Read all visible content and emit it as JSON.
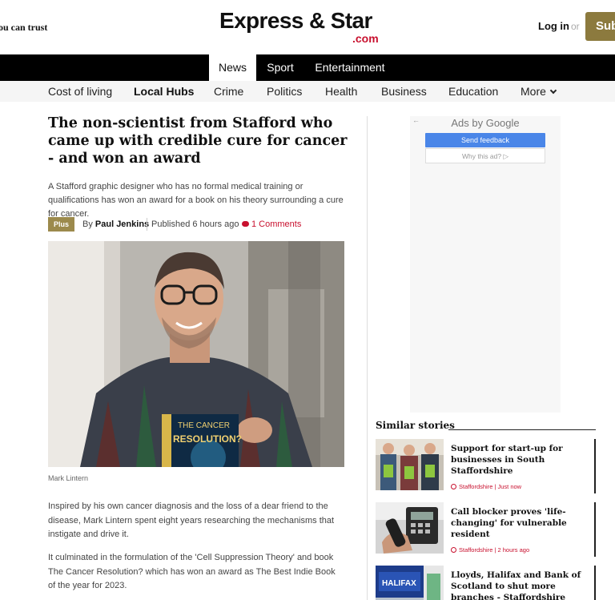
{
  "header": {
    "tagline": "ou can trust",
    "logo_main": "Express & Star",
    "logo_com": ".com",
    "login": "Log in",
    "or": "or",
    "subscribe": "Sub"
  },
  "primary_nav": [
    {
      "label": "News",
      "active": true
    },
    {
      "label": "Sport",
      "active": false
    },
    {
      "label": "Entertainment",
      "active": false
    }
  ],
  "secondary_nav": [
    {
      "label": "Cost of living"
    },
    {
      "label": "Local Hubs"
    },
    {
      "label": "Crime"
    },
    {
      "label": "Politics"
    },
    {
      "label": "Health"
    },
    {
      "label": "Business"
    },
    {
      "label": "Education"
    },
    {
      "label": "More"
    }
  ],
  "article": {
    "headline": "The non-scientist from Stafford who came up with credible cure for cancer - and won an award",
    "standfirst": "A Stafford graphic designer who has no formal medical training or qualifications has won an award for a book on his theory surrounding a cure for cancer.",
    "badge": "Plus",
    "by": "By",
    "author": "Paul Jenkins",
    "published": "Published 6 hours ago",
    "comments": "1 Comments",
    "book_title_line1": "THE CANCER",
    "book_title_line2": "RESOLUTION?",
    "caption": "Mark Lintern",
    "paragraphs": [
      "Inspired by his own cancer diagnosis and the loss of a dear friend to the disease, Mark Lintern spent eight years researching the mechanisms that instigate and drive it.",
      "It culminated in the formulation of the 'Cell Suppression Theory' and book The Cancer Resolution? which has won an award as The Best Indie Book of the year for 2023."
    ]
  },
  "ad": {
    "back": "←",
    "title": "Ads by Google",
    "feedback": "Send feedback",
    "why": "Why this ad? ▷"
  },
  "similar": {
    "title": "Similar stories",
    "stories": [
      {
        "title": "Support for start-up for businesses in South Staffordshire",
        "meta": "Staffordshire | Just now"
      },
      {
        "title": "Call blocker proves 'life-changing' for vulnerable resident",
        "meta": "Staffordshire | 2 hours ago"
      },
      {
        "title": "Lloyds, Halifax and Bank of Scotland to shut more branches - Staffordshire town affected",
        "meta": ""
      }
    ],
    "halifax_logo": "HALIFAX"
  },
  "colors": {
    "accent_red": "#c8102e",
    "gold": "#8c7a3e",
    "nav_black": "#000000"
  }
}
